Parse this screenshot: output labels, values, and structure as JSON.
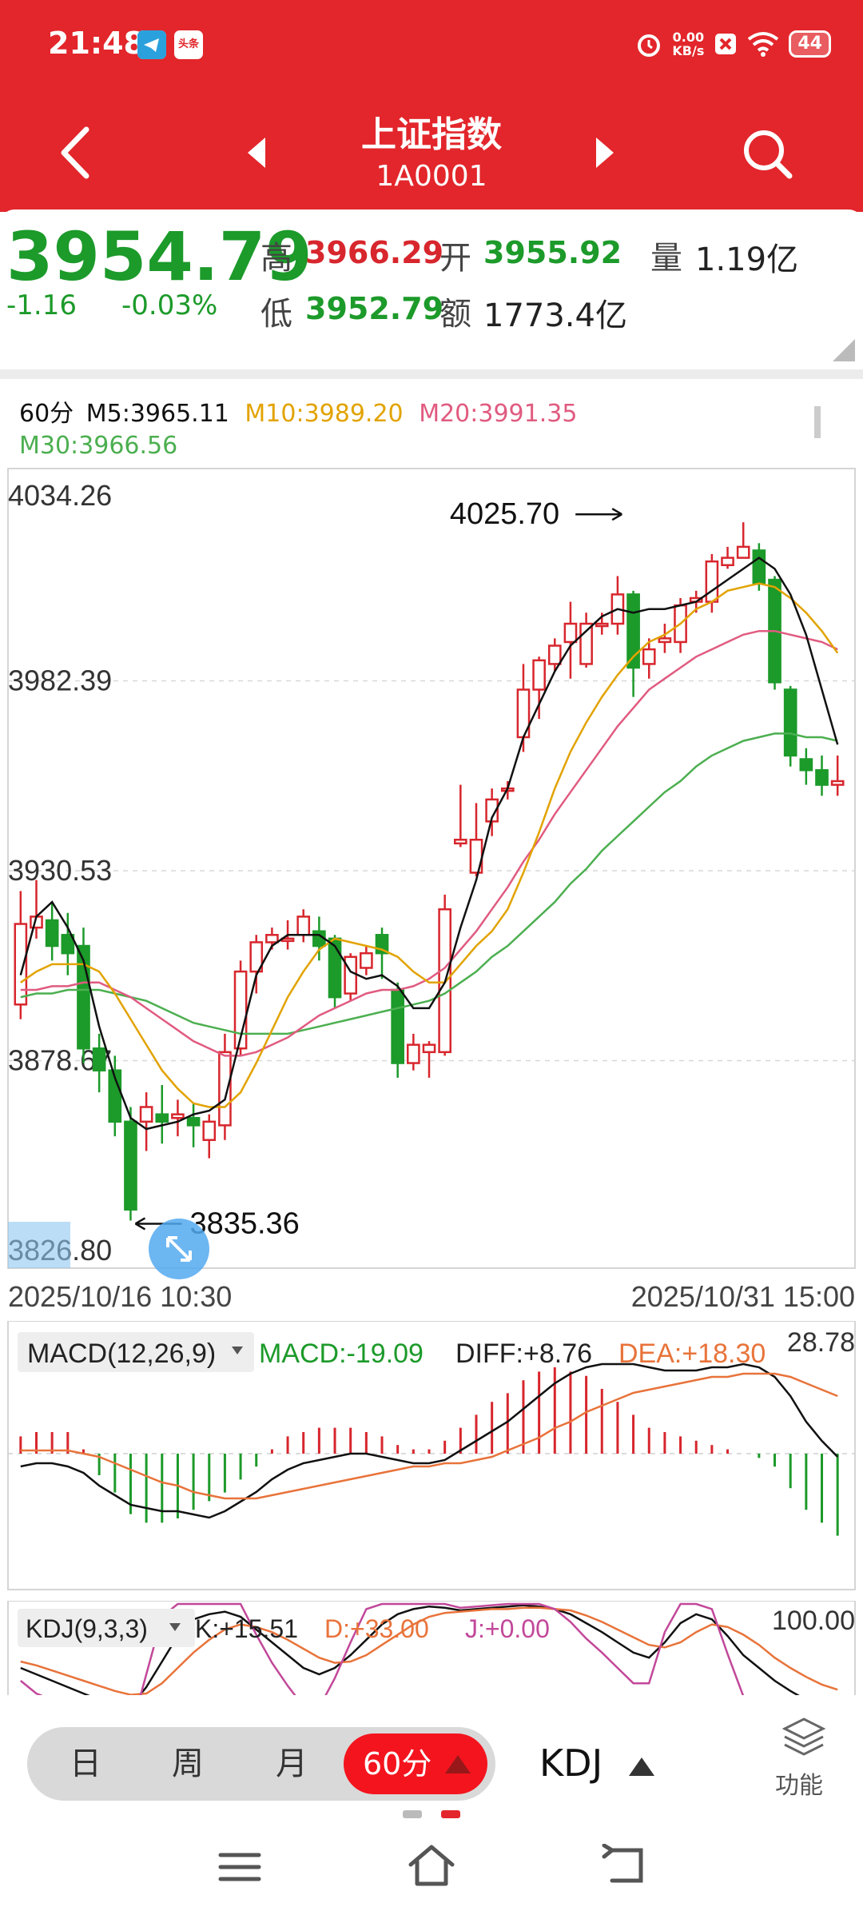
{
  "status_bar": {
    "time": "21:48",
    "net_speed_value": "0.00",
    "net_speed_unit": "KB/s",
    "battery": "44",
    "app_icon_label": "头条"
  },
  "nav": {
    "title": "上证指数",
    "code": "1A0001"
  },
  "quote": {
    "price": "3954.79",
    "change": "-1.16",
    "change_pct": "-0.03%",
    "high_label": "高",
    "high": "3966.29",
    "open_label": "开",
    "open": "3955.92",
    "volume_label": "量",
    "volume": "1.19亿",
    "low_label": "低",
    "low": "3952.79",
    "amount_label": "额",
    "amount": "1773.4亿"
  },
  "ma_legend": {
    "period": "60分",
    "m5": "M5:3965.11",
    "m10": "M10:3989.20",
    "m20": "M20:3991.35",
    "m30": "M30:3966.56"
  },
  "colors": {
    "brand_red": "#e2262b",
    "up_red": "#d7262d",
    "down_green": "#1c9a2a",
    "ma5": "#111111",
    "ma10": "#e2a300",
    "ma20": "#e05b80",
    "ma30": "#4caf50"
  },
  "chart_data": [
    {
      "type": "candlestick",
      "title": "",
      "y_ticks": [
        "4034.26",
        "3982.39",
        "3930.53",
        "3878.67",
        "3826.80"
      ],
      "ylim": [
        3826.8,
        4034.26
      ],
      "x_start_label": "2025/10/16 10:30",
      "x_end_label": "2025/10/31 15:00",
      "max_annotation": "4025.70",
      "min_annotation": "3835.36",
      "candles": [
        [
          3894,
          3916,
          3925,
          3890
        ],
        [
          3915,
          3918,
          3928,
          3912
        ],
        [
          3917,
          3910,
          3922,
          3906
        ],
        [
          3913,
          3908,
          3919,
          3902
        ],
        [
          3910,
          3882,
          3915,
          3878
        ],
        [
          3882,
          3876,
          3886,
          3870
        ],
        [
          3876,
          3862,
          3880,
          3858
        ],
        [
          3862,
          3838,
          3866,
          3835
        ],
        [
          3862,
          3866,
          3870,
          3854
        ],
        [
          3864,
          3862,
          3872,
          3856
        ],
        [
          3863,
          3864,
          3868,
          3858
        ],
        [
          3863,
          3861,
          3867,
          3855
        ],
        [
          3857,
          3862,
          3864,
          3852
        ],
        [
          3861,
          3881,
          3886,
          3857
        ],
        [
          3882,
          3903,
          3906,
          3880
        ],
        [
          3903,
          3911,
          3913,
          3897
        ],
        [
          3911,
          3913,
          3915,
          3909
        ],
        [
          3912,
          3912,
          3917,
          3909
        ],
        [
          3913,
          3918,
          3920,
          3911
        ],
        [
          3914,
          3910,
          3918,
          3906
        ],
        [
          3912,
          3896,
          3913,
          3893
        ],
        [
          3897,
          3907,
          3908,
          3895
        ],
        [
          3904,
          3908,
          3910,
          3902
        ],
        [
          3913,
          3908,
          3915,
          3901
        ],
        [
          3898,
          3878,
          3900,
          3874
        ],
        [
          3878,
          3883,
          3886,
          3876
        ],
        [
          3881,
          3883,
          3884,
          3874
        ],
        [
          3881,
          3920,
          3924,
          3880
        ],
        [
          3938,
          3939,
          3954,
          3937
        ],
        [
          3930,
          3939,
          3949,
          3929
        ],
        [
          3944,
          3950,
          3953,
          3940
        ],
        [
          3953,
          3953,
          3955,
          3950
        ],
        [
          3967,
          3980,
          3987,
          3963
        ],
        [
          3980,
          3988,
          3989,
          3972
        ],
        [
          3987,
          3992,
          3994,
          3985
        ],
        [
          3993,
          3998,
          4004,
          3983
        ],
        [
          3987,
          3998,
          4001,
          3986
        ],
        [
          3998,
          3998,
          4001,
          3995
        ],
        [
          3998,
          4006,
          4011,
          3995
        ],
        [
          4006,
          3986,
          4007,
          3978
        ],
        [
          3987,
          3991,
          3994,
          3983
        ],
        [
          3993,
          3994,
          3998,
          3990
        ],
        [
          3993,
          4003,
          4005,
          3990
        ],
        [
          4004,
          4005,
          4007,
          4001
        ],
        [
          4004,
          4015,
          4017,
          4001
        ],
        [
          4014,
          4016,
          4019,
          4013
        ],
        [
          4016,
          4019,
          4025.7,
          4016
        ],
        [
          4018,
          4009,
          4020,
          4007
        ],
        [
          4010,
          3982,
          4011,
          3980
        ],
        [
          3980,
          3962,
          3981,
          3959
        ],
        [
          3961,
          3958,
          3964,
          3954
        ],
        [
          3958,
          3954,
          3962,
          3951
        ],
        [
          3954,
          3955,
          3962,
          3951
        ]
      ],
      "series": [
        {
          "name": "M5",
          "values": [
            3902,
            3918,
            3922,
            3915,
            3906,
            3888,
            3874,
            3863,
            3860,
            3861,
            3862,
            3864,
            3865,
            3868,
            3885,
            3902,
            3910,
            3913,
            3913,
            3913,
            3910,
            3903,
            3901,
            3902,
            3899,
            3893,
            3893,
            3900,
            3915,
            3928,
            3945,
            3953,
            3967,
            3976,
            3985,
            3992,
            3996,
            4000,
            4002,
            4001,
            4002,
            4002,
            4003,
            4004,
            4007,
            4010,
            4013,
            4016,
            4013,
            4006,
            3995,
            3980,
            3965
          ]
        },
        {
          "name": "M10",
          "values": [
            3900,
            3903,
            3905,
            3905,
            3905,
            3903,
            3897,
            3890,
            3883,
            3876,
            3871,
            3867,
            3866,
            3866,
            3870,
            3878,
            3887,
            3896,
            3903,
            3909,
            3912,
            3911,
            3910,
            3909,
            3907,
            3903,
            3900,
            3900,
            3905,
            3910,
            3914,
            3920,
            3930,
            3941,
            3953,
            3963,
            3971,
            3978,
            3984,
            3989,
            3993,
            3995,
            3998,
            4002,
            4004,
            4007,
            4008,
            4009,
            4008,
            4005,
            4001,
            3996,
            3990
          ]
        },
        {
          "name": "M20",
          "values": [
            3898,
            3898,
            3899,
            3899,
            3900,
            3900,
            3898,
            3896,
            3893,
            3890,
            3887,
            3884,
            3882,
            3880,
            3880,
            3881,
            3883,
            3885,
            3888,
            3891,
            3893,
            3895,
            3897,
            3898,
            3898,
            3899,
            3901,
            3904,
            3909,
            3914,
            3920,
            3926,
            3933,
            3939,
            3946,
            3952,
            3958,
            3964,
            3970,
            3975,
            3980,
            3983,
            3986,
            3989,
            3991,
            3993,
            3995,
            3996,
            3996,
            3995,
            3994,
            3993,
            3991
          ]
        },
        {
          "name": "M30",
          "values": [
            3896,
            3897,
            3897,
            3898,
            3898,
            3898,
            3897,
            3896,
            3895,
            3893,
            3891,
            3889,
            3888,
            3887,
            3886,
            3886,
            3886,
            3886,
            3887,
            3888,
            3889,
            3890,
            3891,
            3892,
            3893,
            3894,
            3895,
            3897,
            3900,
            3903,
            3907,
            3910,
            3914,
            3918,
            3922,
            3927,
            3931,
            3936,
            3940,
            3944,
            3948,
            3952,
            3955,
            3959,
            3962,
            3964,
            3966,
            3967,
            3968,
            3968,
            3967,
            3967,
            3966
          ]
        }
      ]
    },
    {
      "type": "bar",
      "title": "MACD(12,26,9)",
      "macd_label": "MACD:-19.09",
      "diff_label": "DIFF:+8.76",
      "dea_label": "DEA:+18.30",
      "max_label": "28.78",
      "ylim": [
        -30,
        30
      ],
      "values": [
        4,
        5,
        5,
        5,
        1,
        -5,
        -9,
        -14,
        -16,
        -16,
        -15,
        -13,
        -11,
        -9,
        -6,
        -3,
        1,
        4,
        5,
        6,
        6,
        6,
        5,
        4,
        2,
        1,
        1,
        3,
        6,
        9,
        12,
        14,
        17,
        19,
        20,
        19,
        18,
        15,
        12,
        9,
        6,
        5,
        4,
        3,
        2,
        1,
        0,
        -1,
        -3,
        -8,
        -13,
        -16,
        -19
      ],
      "series": [
        {
          "name": "DIFF",
          "values": [
            -4,
            -3,
            -3,
            -4,
            -6,
            -10,
            -13,
            -16,
            -17,
            -18,
            -18,
            -19,
            -20,
            -18,
            -15,
            -12,
            -8,
            -5,
            -3,
            -2,
            -1,
            0,
            0,
            -1,
            -2,
            -3,
            -3,
            -2,
            1,
            4,
            7,
            10,
            14,
            18,
            22,
            25,
            27,
            28,
            28,
            28,
            27,
            26,
            26,
            26,
            27,
            27,
            28,
            27,
            24,
            18,
            10,
            4,
            -1
          ]
        },
        {
          "name": "DEA",
          "values": [
            1,
            1,
            1,
            1,
            0,
            -1,
            -3,
            -5,
            -7,
            -9,
            -10,
            -12,
            -13,
            -14,
            -14,
            -14,
            -13,
            -12,
            -11,
            -10,
            -9,
            -8,
            -7,
            -6,
            -5,
            -4,
            -4,
            -3,
            -3,
            -2,
            -1,
            1,
            3,
            5,
            8,
            10,
            13,
            15,
            17,
            19,
            20,
            21,
            22,
            23,
            24,
            24,
            25,
            25,
            25,
            24,
            22,
            20,
            18
          ]
        }
      ]
    },
    {
      "type": "line",
      "title": "KDJ(9,3,3)",
      "k_label": "K:+15.51",
      "d_label": "D:+33.00",
      "j_label": "J:+0.00",
      "max_label": "100.00",
      "ylim": [
        0,
        100
      ],
      "series": [
        {
          "name": "K",
          "values": [
            50,
            45,
            40,
            35,
            30,
            25,
            22,
            20,
            35,
            55,
            75,
            88,
            92,
            94,
            90,
            80,
            70,
            60,
            50,
            45,
            50,
            60,
            72,
            84,
            92,
            96,
            98,
            97,
            95,
            96,
            97,
            98,
            99,
            98,
            96,
            92,
            85,
            78,
            70,
            62,
            58,
            70,
            85,
            92,
            88,
            75,
            60,
            50,
            40,
            32,
            25,
            20,
            15.51
          ]
        },
        {
          "name": "D",
          "values": [
            55,
            52,
            48,
            44,
            40,
            36,
            32,
            29,
            30,
            38,
            50,
            62,
            72,
            80,
            84,
            82,
            78,
            72,
            65,
            58,
            54,
            55,
            60,
            68,
            76,
            84,
            90,
            93,
            94,
            95,
            96,
            96,
            97,
            97,
            96,
            95,
            91,
            86,
            80,
            74,
            68,
            66,
            70,
            78,
            84,
            82,
            76,
            68,
            58,
            50,
            43,
            37,
            33
          ]
        },
        {
          "name": "J",
          "values": [
            40,
            30,
            25,
            18,
            10,
            5,
            2,
            0,
            45,
            90,
            100,
            100,
            100,
            100,
            100,
            76,
            54,
            36,
            20,
            19,
            42,
            70,
            96,
            100,
            100,
            100,
            100,
            100,
            97,
            98,
            99,
            100,
            100,
            100,
            96,
            86,
            73,
            62,
            50,
            38,
            38,
            78,
            100,
            100,
            96,
            61,
            28,
            14,
            4,
            0,
            0,
            0,
            0
          ]
        }
      ]
    }
  ],
  "bottom": {
    "periods": [
      "日",
      "周",
      "月"
    ],
    "active_period": "60分",
    "indicator": "KDJ",
    "func_label": "功能"
  }
}
